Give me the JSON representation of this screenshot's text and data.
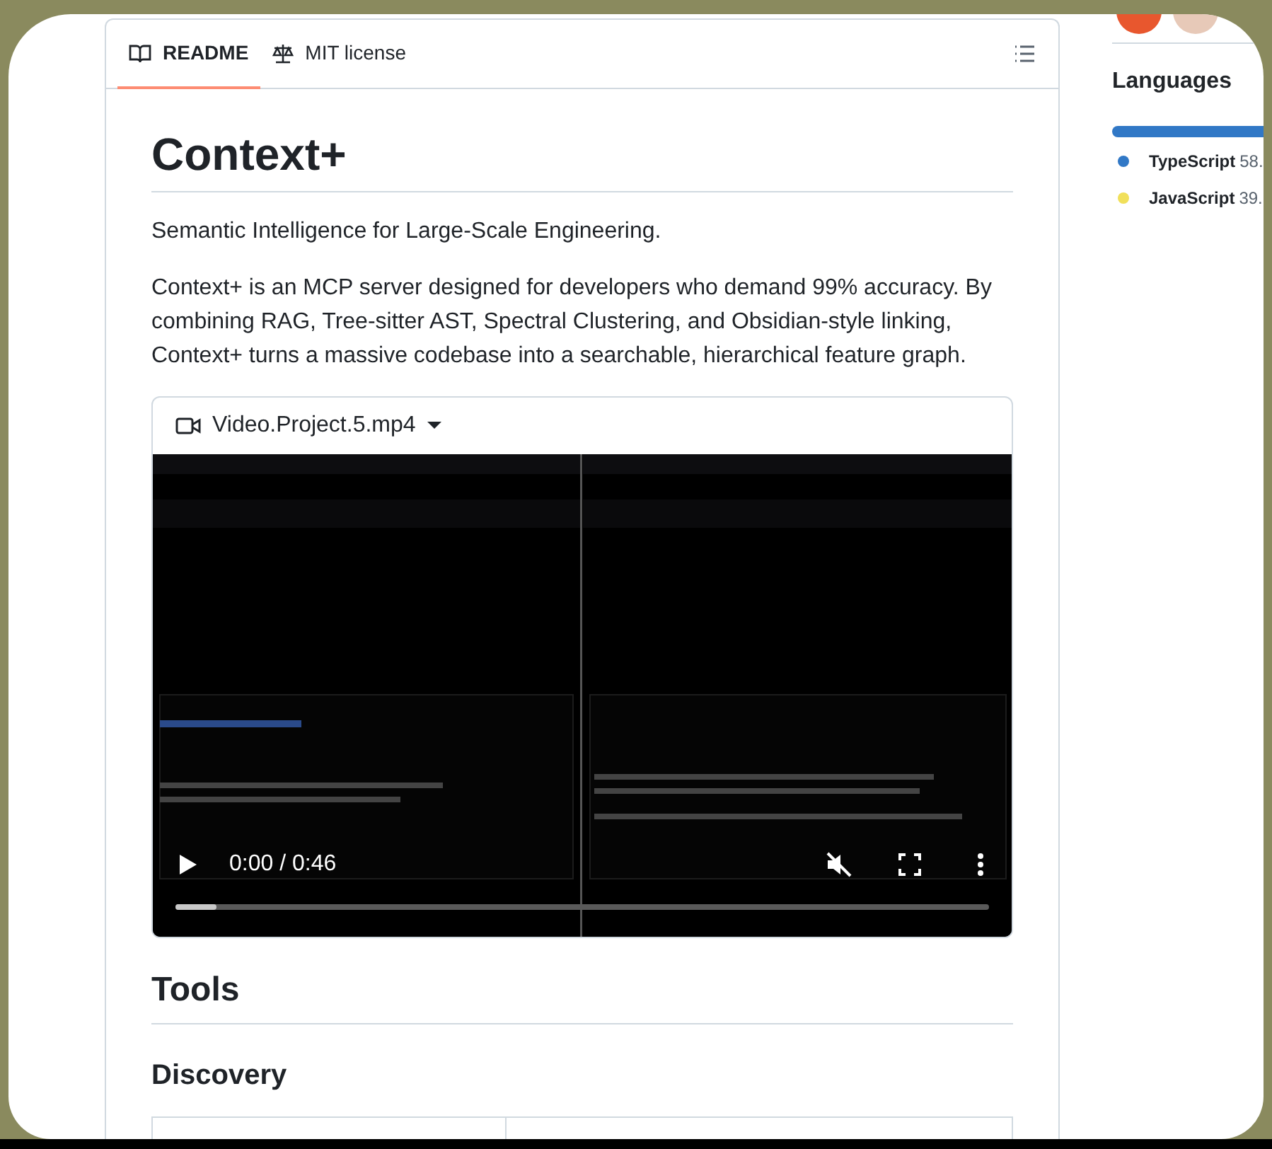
{
  "tabs": [
    {
      "label": "README",
      "kind": "readme",
      "selected": true
    },
    {
      "label": "MIT license",
      "kind": "license",
      "selected": false
    }
  ],
  "readme": {
    "title": "Context+",
    "tagline": "Semantic Intelligence for Large-Scale Engineering.",
    "description": "Context+ is an MCP server designed for developers who demand 99% accuracy. By combining RAG, Tree-sitter AST, Spectral Clustering, and Obsidian-style linking, Context+ turns a massive codebase into a searchable, hierarchical feature graph.",
    "video": {
      "filename": "Video.Project.5.mp4",
      "time": "0:00 / 0:46",
      "muted": true,
      "level": 0.05
    },
    "sections": [
      {
        "kind": "h2",
        "text": "Tools"
      },
      {
        "kind": "h3",
        "text": "Discovery"
      }
    ]
  },
  "sidebar": {
    "heading": "Languages",
    "languages": [
      {
        "name": "TypeScript",
        "percent": "58.",
        "color": "#3178c6"
      },
      {
        "name": "JavaScript",
        "percent": "39.",
        "color": "#f1e05a"
      }
    ]
  }
}
